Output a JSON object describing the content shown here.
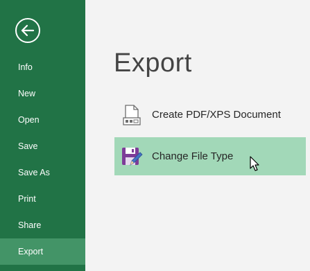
{
  "sidebar": {
    "back_button": {
      "icon": "arrow-left-icon"
    },
    "items": [
      {
        "label": "Info"
      },
      {
        "label": "New"
      },
      {
        "label": "Open"
      },
      {
        "label": "Save"
      },
      {
        "label": "Save As"
      },
      {
        "label": "Print"
      },
      {
        "label": "Share"
      },
      {
        "label": "Export",
        "selected": true
      }
    ]
  },
  "main": {
    "title": "Export",
    "options": [
      {
        "label": "Create PDF/XPS Document",
        "icon": "pdf-document-icon"
      },
      {
        "label": "Change File Type",
        "icon": "floppy-disk-pencil-icon",
        "selected": true
      }
    ]
  },
  "colors": {
    "sidebar_bg": "#217346",
    "sidebar_selected": "#439467",
    "content_bg": "#f3f3f3",
    "option_selected": "#a2d8b8"
  }
}
